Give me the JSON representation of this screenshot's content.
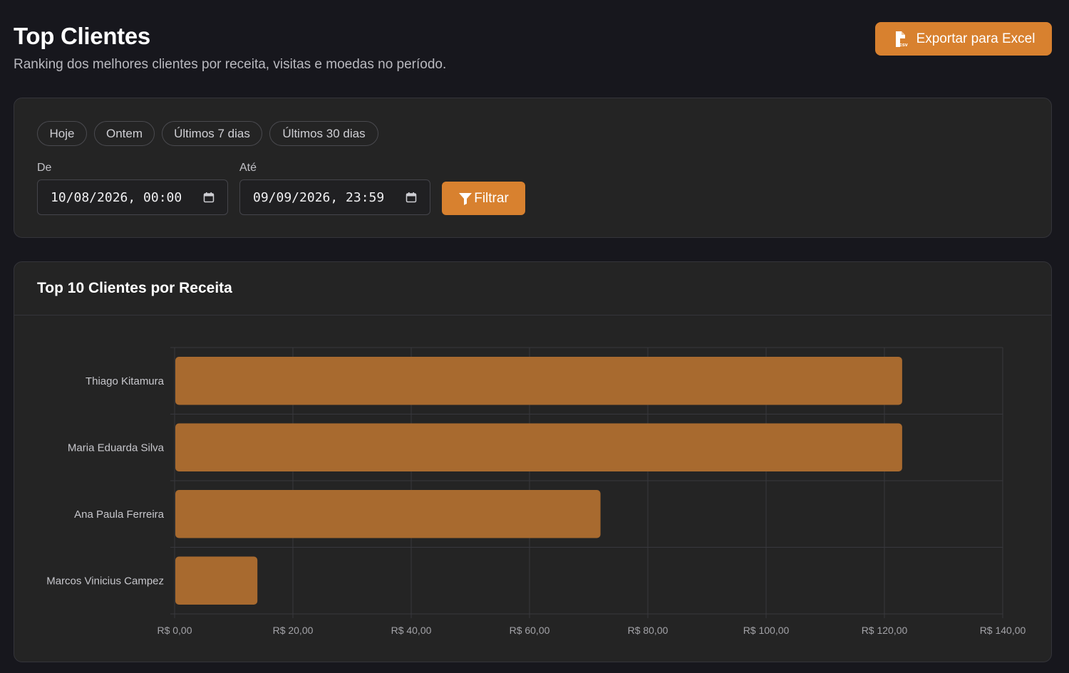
{
  "header": {
    "title": "Top Clientes",
    "subtitle": "Ranking dos melhores clientes por receita, visitas e moedas no período.",
    "export_label": "Exportar para Excel",
    "export_icon": "file-csv-icon"
  },
  "filters": {
    "presets": [
      "Hoje",
      "Ontem",
      "Últimos 7 dias",
      "Últimos 30 dias"
    ],
    "from_label": "De",
    "from_value": "10/08/2026, 00:00",
    "to_label": "Até",
    "to_value": "09/09/2026, 23:59",
    "filter_label": "Filtrar",
    "filter_icon": "funnel-icon",
    "calendar_icon": "calendar-icon"
  },
  "colors": {
    "accent": "#d8812f",
    "bar": "#a86a2f",
    "background": "#17171d",
    "card": "#242424"
  },
  "chart": {
    "title": "Top 10 Clientes por Receita"
  },
  "chart_data": {
    "type": "bar",
    "orientation": "horizontal",
    "categories": [
      "Thiago Kitamura",
      "Maria Eduarda Silva",
      "Ana Paula Ferreira",
      "Marcos Vinicius Campez"
    ],
    "values": [
      123,
      123,
      72,
      14
    ],
    "xlim": [
      0,
      140
    ],
    "xticks": [
      0,
      20,
      40,
      60,
      80,
      100,
      120,
      140
    ],
    "xtick_labels": [
      "R$ 0,00",
      "R$ 20,00",
      "R$ 40,00",
      "R$ 60,00",
      "R$ 80,00",
      "R$ 100,00",
      "R$ 120,00",
      "R$ 140,00"
    ],
    "grid": true,
    "legend": "none"
  }
}
